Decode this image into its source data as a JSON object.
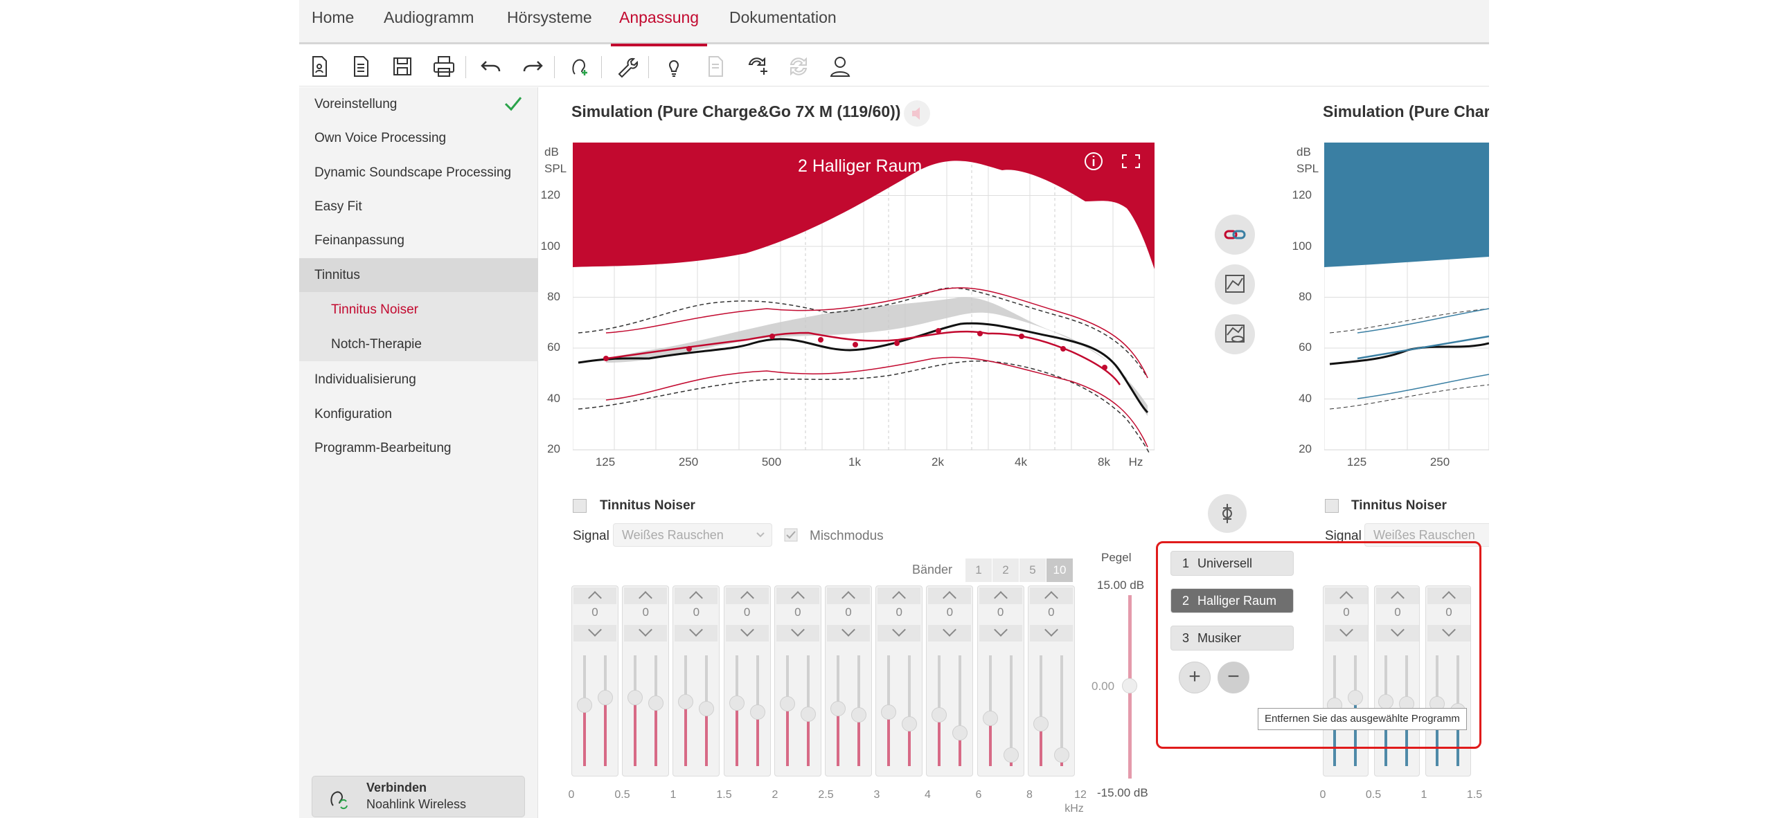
{
  "nav": {
    "tabs": [
      "Home",
      "Audiogramm",
      "Hörsysteme",
      "Anpassung",
      "Dokumentation"
    ],
    "active": "Anpassung"
  },
  "sidebar": {
    "items": [
      {
        "label": "Voreinstellung",
        "done": true
      },
      {
        "label": "Own Voice Processing"
      },
      {
        "label": "Dynamic Soundscape Processing"
      },
      {
        "label": "Easy Fit"
      },
      {
        "label": "Feinanpassung"
      },
      {
        "label": "Tinnitus"
      },
      {
        "label": "Tinnitus Noiser"
      },
      {
        "label": "Notch-Therapie"
      },
      {
        "label": "Individualisierung"
      },
      {
        "label": "Konfiguration"
      },
      {
        "label": "Programm-Bearbeitung"
      }
    ],
    "connect": {
      "title": "Verbinden",
      "subtitle": "Noahlink Wireless"
    }
  },
  "simulation_left": {
    "title": "Simulation (Pure Charge&Go 7X M (119/60))",
    "program_label": "2 Halliger Raum"
  },
  "simulation_right": {
    "title": "Simulation (Pure Charg"
  },
  "chart": {
    "y_unit": "dB",
    "y_unit2": "SPL",
    "y_ticks": [
      "120",
      "100",
      "80",
      "60",
      "40",
      "20"
    ],
    "x_ticks": [
      "125",
      "250",
      "500",
      "1k",
      "2k",
      "4k",
      "8k",
      "Hz"
    ],
    "x_ticks_right": [
      "125",
      "250"
    ],
    "colors": {
      "left_ear": "#c2092f",
      "right_ear": "#3a7fa3"
    }
  },
  "tinnitus": {
    "checkbox_label": "Tinnitus Noiser",
    "signal_label": "Signal",
    "signal_value": "Weißes Rauschen",
    "mix_label": "Mischmodus",
    "bands_label": "Bänder",
    "bands": [
      "1",
      "2",
      "5",
      "10"
    ],
    "active_band": "10",
    "pegel_label": "Pegel",
    "pegel_max": "15.00 dB",
    "pegel_mid": "0.00",
    "pegel_min": "-15.00 dB",
    "slider_values": [
      "0",
      "0",
      "0",
      "0",
      "0",
      "0",
      "0",
      "0",
      "0",
      "0"
    ],
    "khz_ticks": [
      "0",
      "0.5",
      "1",
      "1.5",
      "2",
      "2.5",
      "3",
      "4",
      "6",
      "8",
      "12"
    ],
    "khz_unit": "kHz",
    "khz_ticks_right": [
      "0",
      "0.5",
      "1",
      "1.5"
    ],
    "slider_values_right": [
      "0",
      "0",
      "0"
    ]
  },
  "programs": {
    "items": [
      {
        "num": "1",
        "name": "Universell"
      },
      {
        "num": "2",
        "name": "Halliger Raum",
        "selected": true
      },
      {
        "num": "3",
        "name": "Musiker"
      }
    ],
    "add_symbol": "+",
    "remove_symbol": "−",
    "tooltip": "Entfernen Sie das ausgewählte Programm"
  }
}
